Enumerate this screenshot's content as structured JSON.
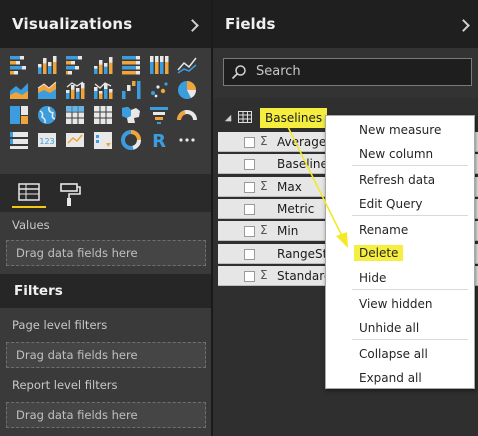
{
  "visualizations": {
    "title": "Visualizations",
    "icons": [
      "stacked-bar-chart-icon",
      "stacked-column-chart-icon",
      "clustered-bar-chart-icon",
      "clustered-column-chart-icon",
      "percent-bar-chart-icon",
      "percent-column-chart-icon",
      "line-chart-icon",
      "area-chart-icon",
      "stacked-area-chart-icon",
      "line-column-chart-icon",
      "line-clustered-column-chart-icon",
      "waterfall-chart-icon",
      "scatter-chart-icon",
      "pie-chart-icon",
      "treemap-icon",
      "map-icon",
      "table-icon",
      "matrix-icon",
      "filled-map-icon",
      "funnel-chart-icon",
      "gauge-icon",
      "multi-row-card-icon",
      "card-icon",
      "kpi-icon",
      "slicer-icon",
      "donut-chart-icon",
      "r-visual-icon",
      "more-visuals-icon"
    ],
    "values_label": "Values",
    "values_placeholder": "Drag data fields here"
  },
  "filters": {
    "title": "Filters",
    "page_label": "Page level filters",
    "page_placeholder": "Drag data fields here",
    "report_label": "Report level filters",
    "report_placeholder": "Drag data fields here"
  },
  "fields": {
    "title": "Fields",
    "search_placeholder": "Search",
    "table_name": "Baselines",
    "items": [
      {
        "name": "Average",
        "sigma": "Σ"
      },
      {
        "name": "Baseline",
        "sigma": ""
      },
      {
        "name": "Max",
        "sigma": "Σ"
      },
      {
        "name": "Metric",
        "sigma": ""
      },
      {
        "name": "Min",
        "sigma": "Σ"
      },
      {
        "name": "RangeStart",
        "sigma": ""
      },
      {
        "name": "Standard",
        "sigma": "Σ"
      }
    ]
  },
  "context_menu": {
    "items": [
      "New measure",
      "New column",
      "Refresh data",
      "Edit Query",
      "Rename",
      "Delete",
      "Hide",
      "View hidden",
      "Unhide all",
      "Collapse all",
      "Expand all"
    ],
    "highlighted": "Delete"
  },
  "colors": {
    "highlight_yellow": "#f5ee3e",
    "accent": "#f2c811",
    "icon_blue": "#3b9ddd",
    "icon_orange": "#f0a43a",
    "icon_white": "#e8e8e8"
  }
}
